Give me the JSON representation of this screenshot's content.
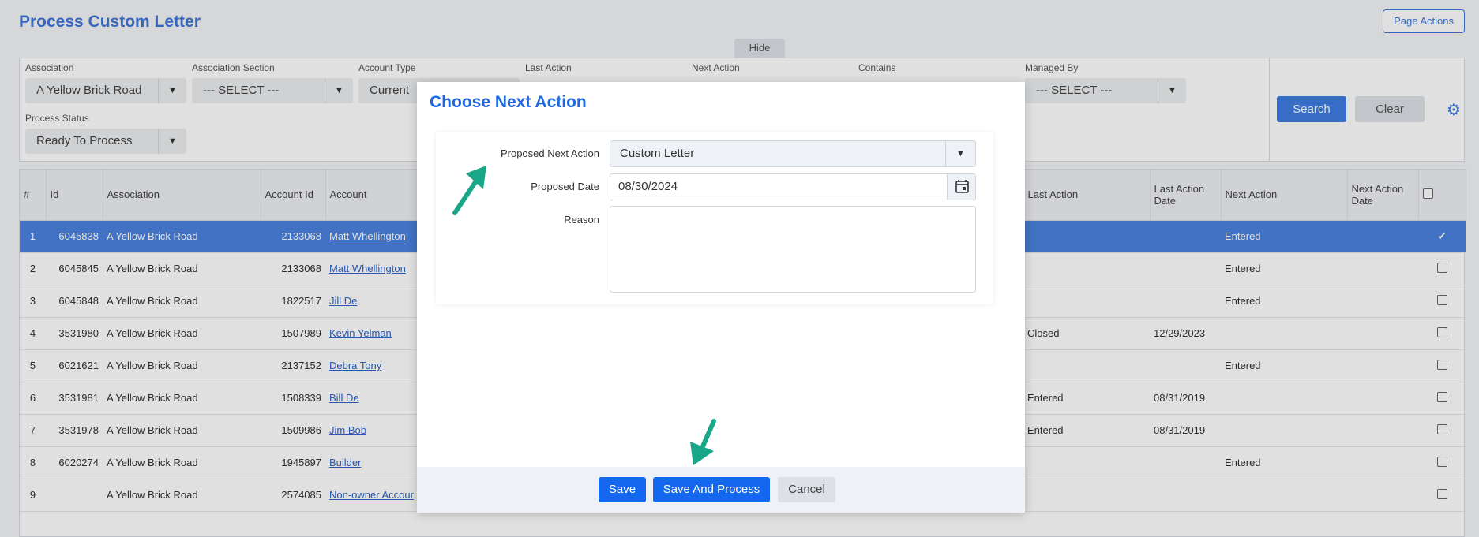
{
  "page": {
    "title": "Process Custom Letter",
    "page_actions_label": "Page Actions",
    "hide_label": "Hide"
  },
  "filters": {
    "association": {
      "label": "Association",
      "value": "A Yellow Brick Road"
    },
    "association_section": {
      "label": "Association Section",
      "value": "--- SELECT ---"
    },
    "account_type": {
      "label": "Account Type",
      "value": "Current"
    },
    "last_action": {
      "label": "Last Action"
    },
    "next_action": {
      "label": "Next Action"
    },
    "contains": {
      "label": "Contains"
    },
    "managed_by": {
      "label": "Managed By",
      "value": "--- SELECT ---"
    },
    "process_status": {
      "label": "Process Status",
      "value": "Ready To Process"
    },
    "search_label": "Search",
    "clear_label": "Clear"
  },
  "table": {
    "headers": {
      "num": "#",
      "id": "Id",
      "association": "Association",
      "account_id": "Account Id",
      "account": "Account",
      "last_action": "Last Action",
      "last_action_date": "Last Action Date",
      "next_action": "Next Action",
      "next_action_date": "Next Action Date"
    },
    "rows": [
      {
        "num": "1",
        "id": "6045838",
        "association": "A Yellow Brick Road",
        "account_id": "2133068",
        "account": "Matt Whellington",
        "last_action": "",
        "last_action_date": "",
        "next_action": "Entered",
        "next_action_date": "",
        "checked": "✔"
      },
      {
        "num": "2",
        "id": "6045845",
        "association": "A Yellow Brick Road",
        "account_id": "2133068",
        "account": "Matt Whellington",
        "last_action": "",
        "last_action_date": "",
        "next_action": "Entered",
        "next_action_date": "",
        "checked": ""
      },
      {
        "num": "3",
        "id": "6045848",
        "association": "A Yellow Brick Road",
        "account_id": "1822517",
        "account": "Jill De",
        "last_action": "",
        "last_action_date": "",
        "next_action": "Entered",
        "next_action_date": "",
        "checked": ""
      },
      {
        "num": "4",
        "id": "3531980",
        "association": "A Yellow Brick Road",
        "account_id": "1507989",
        "account": "Kevin Yelman",
        "last_action": "Closed",
        "last_action_date": "12/29/2023",
        "next_action": "",
        "next_action_date": "",
        "checked": ""
      },
      {
        "num": "5",
        "id": "6021621",
        "association": "A Yellow Brick Road",
        "account_id": "2137152",
        "account": "Debra Tony",
        "last_action": "",
        "last_action_date": "",
        "next_action": "Entered",
        "next_action_date": "",
        "checked": ""
      },
      {
        "num": "6",
        "id": "3531981",
        "association": "A Yellow Brick Road",
        "account_id": "1508339",
        "account": "Bill De",
        "last_action": "Entered",
        "last_action_date": "08/31/2019",
        "next_action": "",
        "next_action_date": "",
        "checked": ""
      },
      {
        "num": "7",
        "id": "3531978",
        "association": "A Yellow Brick Road",
        "account_id": "1509986",
        "account": "Jim Bob",
        "last_action": "Entered",
        "last_action_date": "08/31/2019",
        "next_action": "",
        "next_action_date": "",
        "checked": ""
      },
      {
        "num": "8",
        "id": "6020274",
        "association": "A Yellow Brick Road",
        "account_id": "1945897",
        "account": "Builder",
        "last_action": "",
        "last_action_date": "",
        "next_action": "Entered",
        "next_action_date": "",
        "checked": ""
      },
      {
        "num": "9",
        "id": "",
        "association": "A Yellow Brick Road",
        "account_id": "2574085",
        "account": "Non-owner Accour",
        "last_action": "",
        "last_action_date": "",
        "next_action": "",
        "next_action_date": "",
        "checked": ""
      }
    ]
  },
  "modal": {
    "title": "Choose Next Action",
    "proposed_next_action_label": "Proposed Next Action",
    "proposed_next_action_value": "Custom Letter",
    "proposed_date_label": "Proposed Date",
    "proposed_date_value": "08/30/2024",
    "reason_label": "Reason",
    "reason_value": "",
    "save_label": "Save",
    "save_and_process_label": "Save And Process",
    "cancel_label": "Cancel"
  },
  "colors": {
    "accent": "#1468f0",
    "selected_row": "#4a82df",
    "annotation_arrow": "#1aa688"
  },
  "icons": {
    "settings": "gear-icon",
    "calendar": "calendar-icon",
    "dropdown": "chevron-down-icon",
    "annotation": "arrow-icon"
  }
}
